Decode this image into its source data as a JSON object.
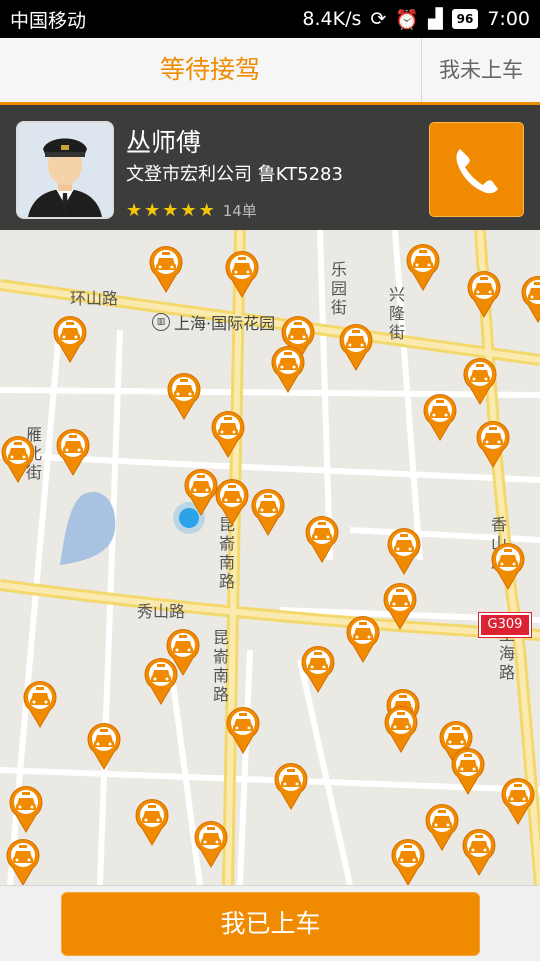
{
  "status_bar": {
    "carrier": "中国移动",
    "speed": "8.4K/s",
    "battery": "96",
    "time": "7:00"
  },
  "header": {
    "title": "等待接驾",
    "cancel_label": "我未上车"
  },
  "driver": {
    "name": "丛师傅",
    "company_plate": "文登市宏利公司 鲁KT5283",
    "rating": 5,
    "orders": "14单"
  },
  "map": {
    "roads": {
      "huanshan": "环山路",
      "xiushan": "秀山路",
      "kunyu1": "昆嵛南路",
      "kunyu2": "昆嵛南路",
      "leyuan": "乐园街",
      "xinglong": "兴隆街",
      "yanbei": "雁北街",
      "xiangshan": "香山路",
      "shenghai": "圣海路"
    },
    "poi": "上海·国际花园",
    "highway": "G309"
  },
  "colors": {
    "accent": "#f08a00",
    "location": "#2aa3e8"
  },
  "footer": {
    "confirm_label": "我已上车"
  }
}
